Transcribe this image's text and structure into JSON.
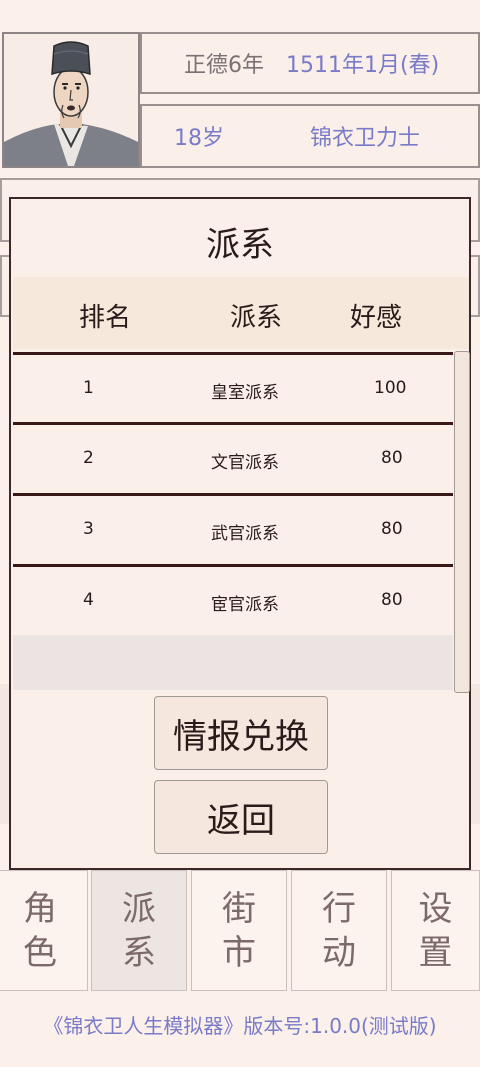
{
  "header": {
    "era": "正德6年",
    "date": "1511年1月(春)",
    "age": "18岁",
    "title": "锦衣卫力士"
  },
  "modal": {
    "title": "派系",
    "columns": [
      "排名",
      "派系",
      "好感"
    ],
    "rows": [
      {
        "rank": "1",
        "faction": "皇室派系",
        "favor": "100"
      },
      {
        "rank": "2",
        "faction": "文官派系",
        "favor": "80"
      },
      {
        "rank": "3",
        "faction": "武官派系",
        "favor": "80"
      },
      {
        "rank": "4",
        "faction": "宦官派系",
        "favor": "80"
      }
    ],
    "exchange_label": "情报兑换",
    "back_label": "返回"
  },
  "nav": {
    "items": [
      {
        "line1": "角",
        "line2": "色"
      },
      {
        "line1": "派",
        "line2": "系"
      },
      {
        "line1": "街",
        "line2": "市"
      },
      {
        "line1": "行",
        "line2": "动"
      },
      {
        "line1": "设",
        "line2": "置"
      }
    ],
    "active_index": 1
  },
  "footer": "《锦衣卫人生模拟器》版本号:1.0.0(测试版)"
}
